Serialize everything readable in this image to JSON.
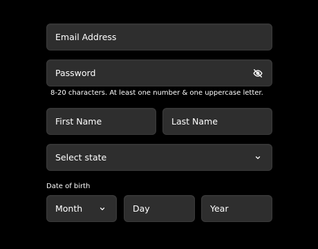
{
  "form": {
    "email": {
      "placeholder": "Email Address"
    },
    "password": {
      "placeholder": "Password",
      "hint": "8-20 characters. At least one number & one uppercase letter."
    },
    "first_name": {
      "placeholder": "First Name"
    },
    "last_name": {
      "placeholder": "Last Name"
    },
    "state": {
      "selected": "Select state"
    },
    "dob": {
      "label": "Date of birth",
      "month": "Month",
      "day": "Day",
      "year": "Year"
    }
  },
  "icons": {
    "password_toggle": "eye-off-icon",
    "dropdown": "chevron-down-icon"
  },
  "colors": {
    "background": "#000000",
    "field_bg": "#2e2e2e",
    "text": "#ffffff"
  }
}
